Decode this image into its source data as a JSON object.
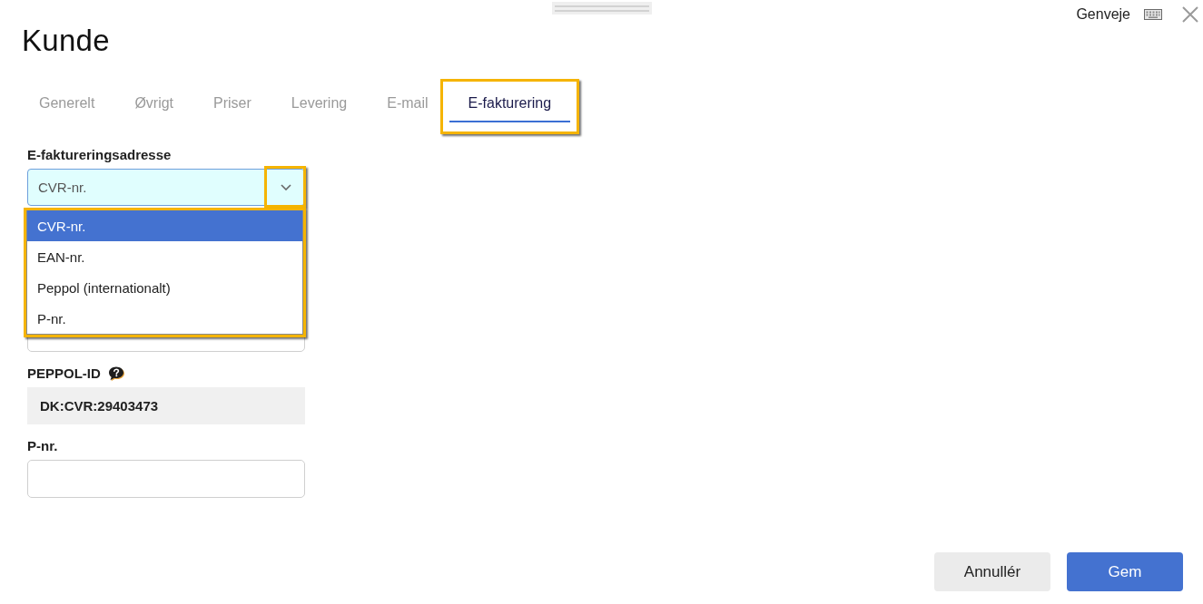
{
  "header": {
    "title": "Kunde",
    "shortcuts_label": "Genveje"
  },
  "tabs": [
    {
      "label": "Generelt",
      "selected": false,
      "highlighted": false
    },
    {
      "label": "Øvrigt",
      "selected": false,
      "highlighted": false
    },
    {
      "label": "Priser",
      "selected": false,
      "highlighted": false
    },
    {
      "label": "Levering",
      "selected": false,
      "highlighted": false
    },
    {
      "label": "E-mail",
      "selected": false,
      "highlighted": false
    },
    {
      "label": "E-fakturering",
      "selected": true,
      "highlighted": true
    }
  ],
  "fields": [
    {
      "kind": "select",
      "label": "E-faktureringsadresse",
      "value": "CVR-nr.",
      "expanded": true,
      "caret_highlighted": true,
      "list_highlighted": true,
      "options": [
        {
          "label": "CVR-nr.",
          "selected": true
        },
        {
          "label": "EAN-nr.",
          "selected": false
        },
        {
          "label": "Peppol (internationalt)",
          "selected": false
        },
        {
          "label": "P-nr.",
          "selected": false
        }
      ]
    },
    {
      "kind": "input"
    },
    {
      "kind": "readonly",
      "label": "PEPPOL-ID",
      "help": true,
      "value": "DK:CVR:29403473"
    },
    {
      "kind": "input",
      "label": "P-nr."
    }
  ],
  "buttons": [
    {
      "kind": "secondary",
      "label": "Annullér"
    },
    {
      "kind": "primary",
      "label": "Gem"
    }
  ]
}
